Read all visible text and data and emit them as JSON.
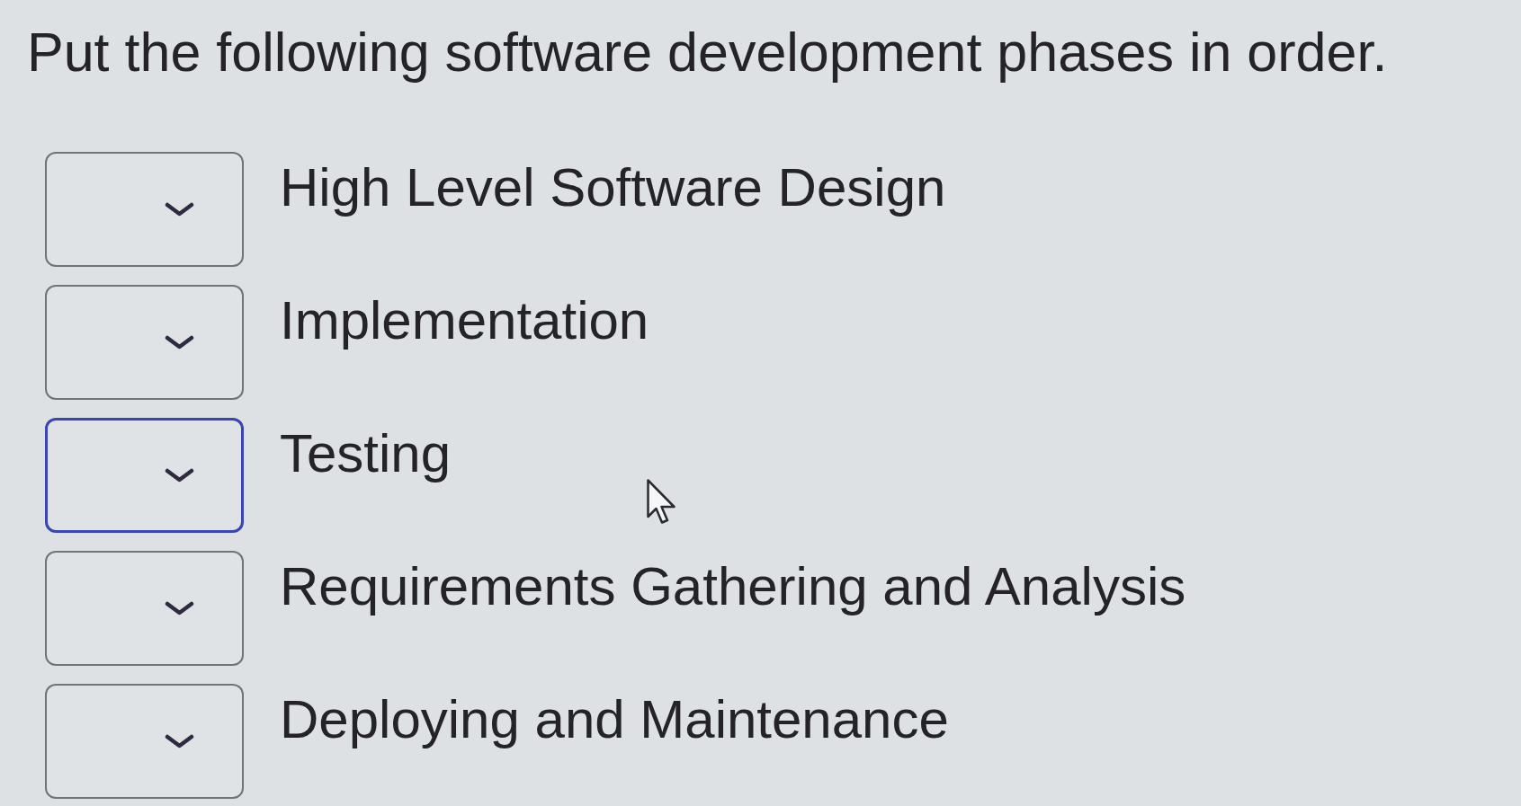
{
  "question": {
    "text": "Put the following software development phases in order."
  },
  "items": [
    {
      "label": "High Level Software Design",
      "focused": false
    },
    {
      "label": "Implementation",
      "focused": false
    },
    {
      "label": "Testing",
      "focused": true
    },
    {
      "label": "Requirements Gathering and Analysis",
      "focused": false
    },
    {
      "label": "Deploying and Maintenance",
      "focused": false
    }
  ]
}
